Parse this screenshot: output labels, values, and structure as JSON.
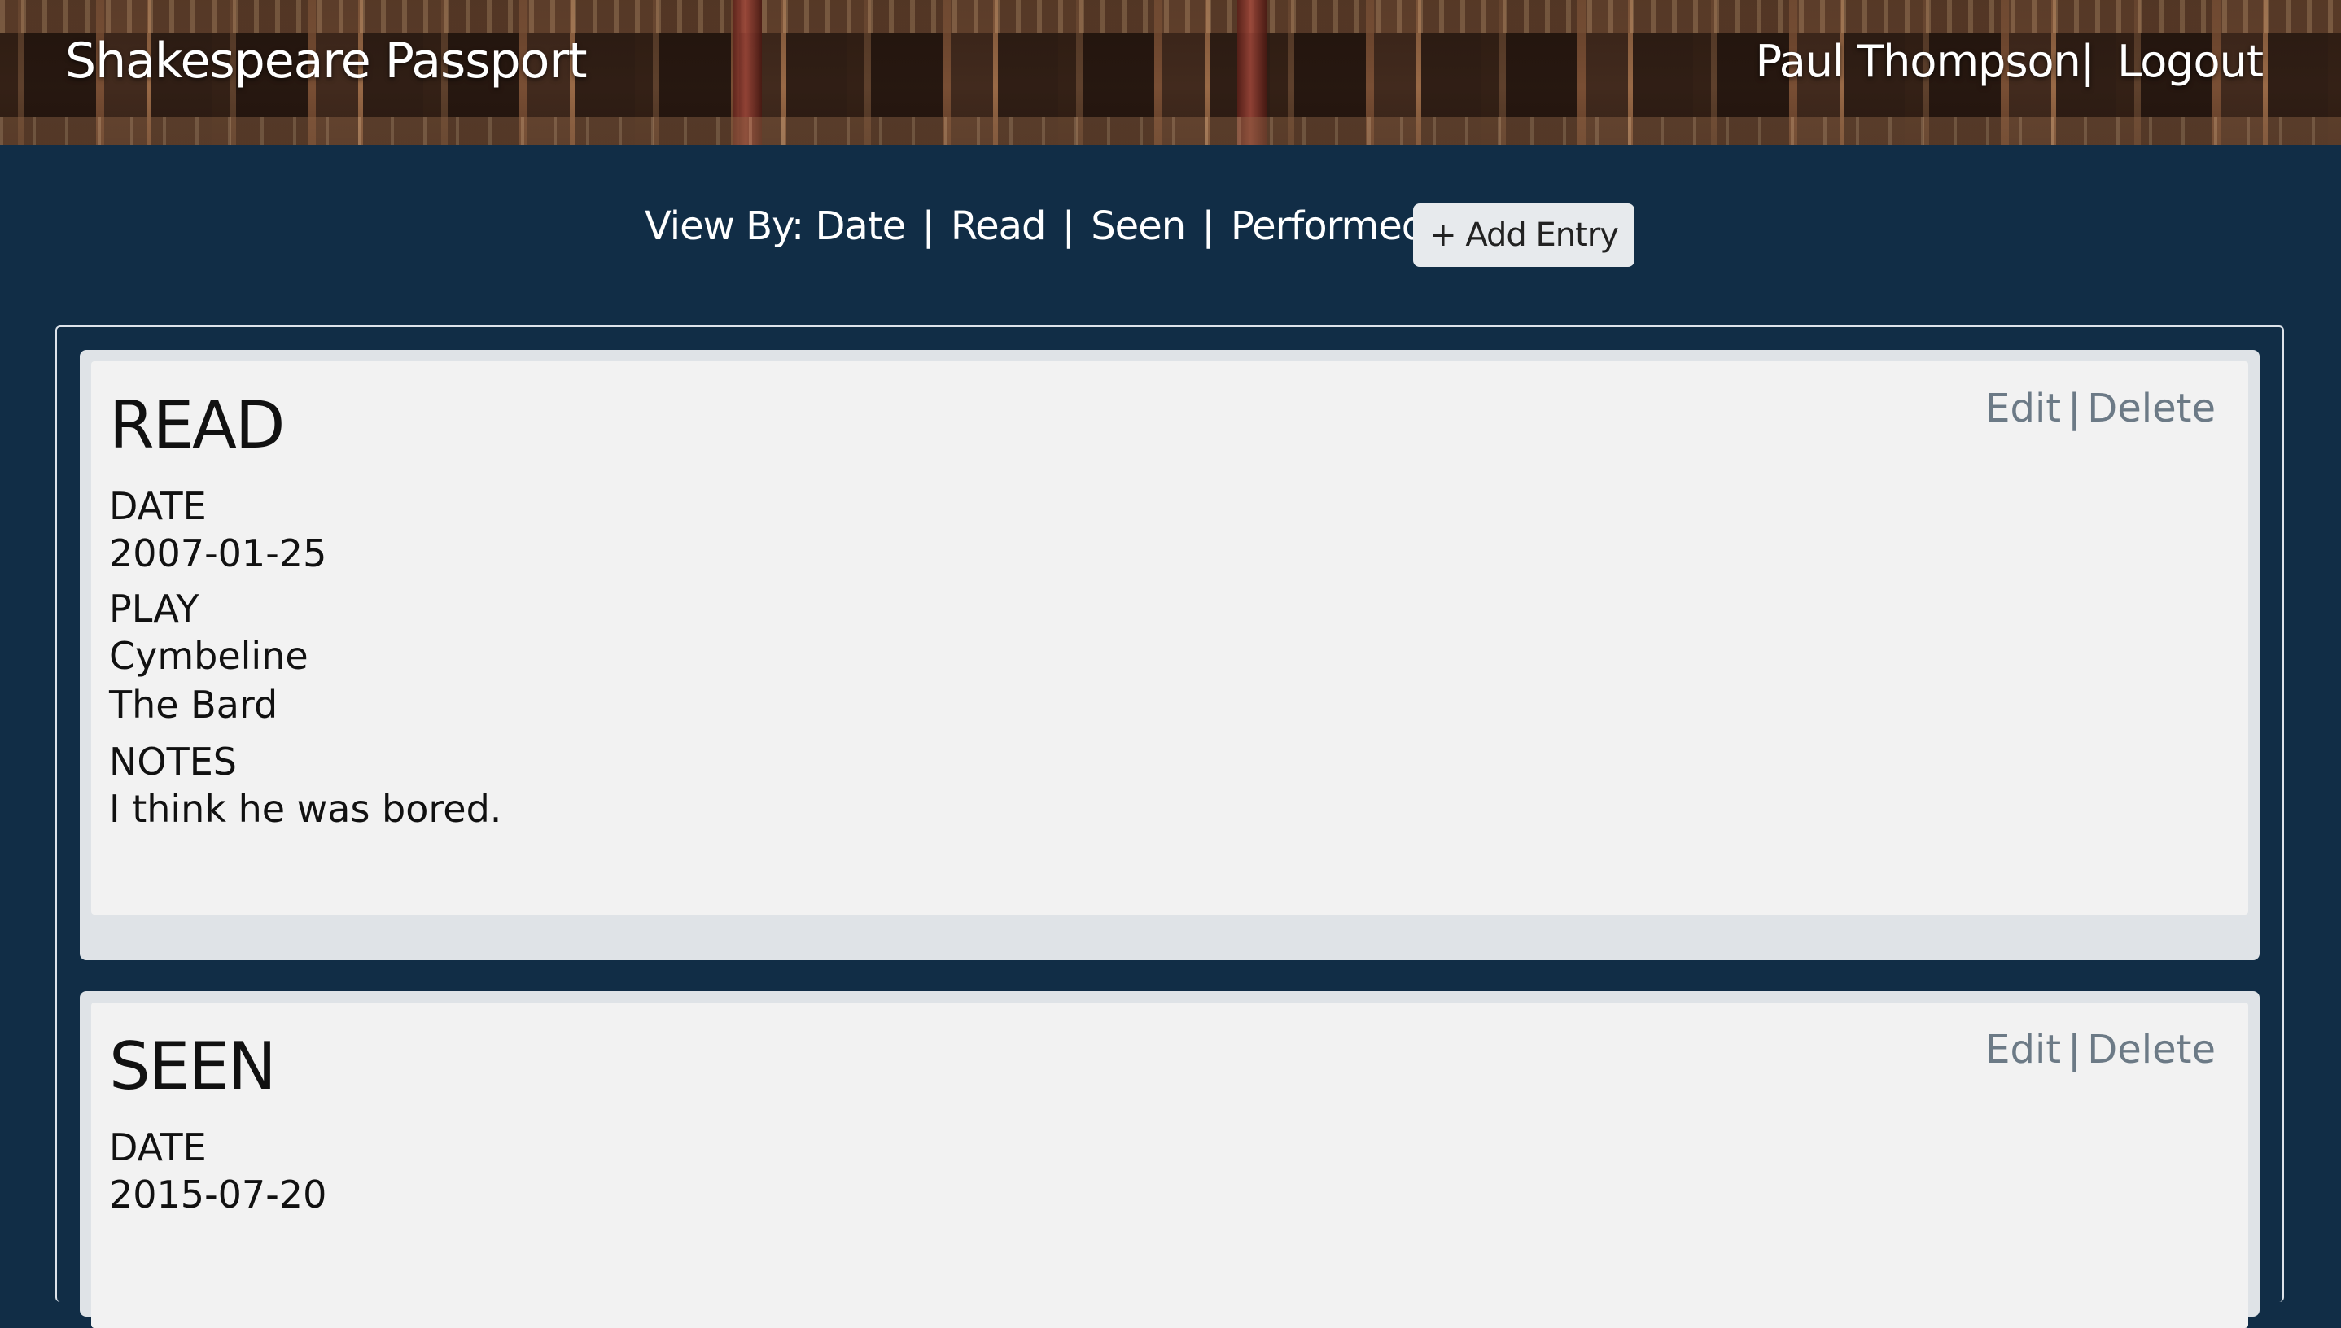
{
  "header": {
    "brand": "Shakespeare Passport",
    "user_name": "Paul Thompson",
    "separator": "|",
    "logout": "Logout"
  },
  "toolbar": {
    "view_by_label": "View By:",
    "views": [
      "Date",
      "Read",
      "Seen",
      "Performed"
    ],
    "separator": "|",
    "add_entry": "+ Add Entry"
  },
  "entries": [
    {
      "type": "READ",
      "date_label": "DATE",
      "date": "2007-01-25",
      "play_label": "PLAY",
      "play": "Cymbeline",
      "author": "The Bard",
      "notes_label": "NOTES",
      "notes": "I think he was bored.",
      "edit": "Edit",
      "delete": "Delete",
      "separator": "|"
    },
    {
      "type": "SEEN",
      "date_label": "DATE",
      "date": "2015-07-20",
      "edit": "Edit",
      "delete": "Delete",
      "separator": "|"
    }
  ]
}
